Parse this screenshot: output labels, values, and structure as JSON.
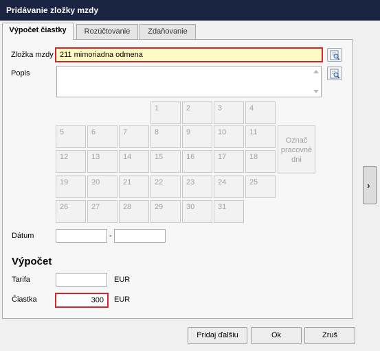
{
  "window": {
    "title": "Pridávanie zložky mzdy"
  },
  "tabs": [
    {
      "label": "Výpočet čiastky"
    },
    {
      "label": "Rozúčtovanie"
    },
    {
      "label": "Zdaňovanie"
    }
  ],
  "form": {
    "component_label": "Zložka mzdy",
    "component_value": "211  mimoriadna odmena",
    "description_label": "Popis",
    "description_value": "",
    "date_label": "Dátum",
    "date_from": "",
    "date_separator": "-",
    "date_to": ""
  },
  "calendar": {
    "days": [
      "1",
      "2",
      "3",
      "4",
      "5",
      "6",
      "7",
      "8",
      "9",
      "10",
      "11",
      "12",
      "13",
      "14",
      "15",
      "16",
      "17",
      "18",
      "19",
      "20",
      "21",
      "22",
      "23",
      "24",
      "25",
      "26",
      "27",
      "28",
      "29",
      "30",
      "31"
    ],
    "mark_label": "Označ pracovné dni"
  },
  "calculation": {
    "title": "Výpočet",
    "rate_label": "Tarifa",
    "rate_value": "",
    "rate_unit": "EUR",
    "amount_label": "Čiastka",
    "amount_value": "300",
    "amount_unit": "EUR"
  },
  "buttons": {
    "add_next": "Pridaj ďalšiu",
    "ok": "Ok",
    "cancel": "Zruš"
  },
  "icons": {
    "lookup": "search-icon",
    "side": "chevron-right-icon"
  },
  "colors": {
    "titlebar": "#1a2544",
    "highlight_border": "#d8232a",
    "highlight_fill": "#fffbc4"
  }
}
